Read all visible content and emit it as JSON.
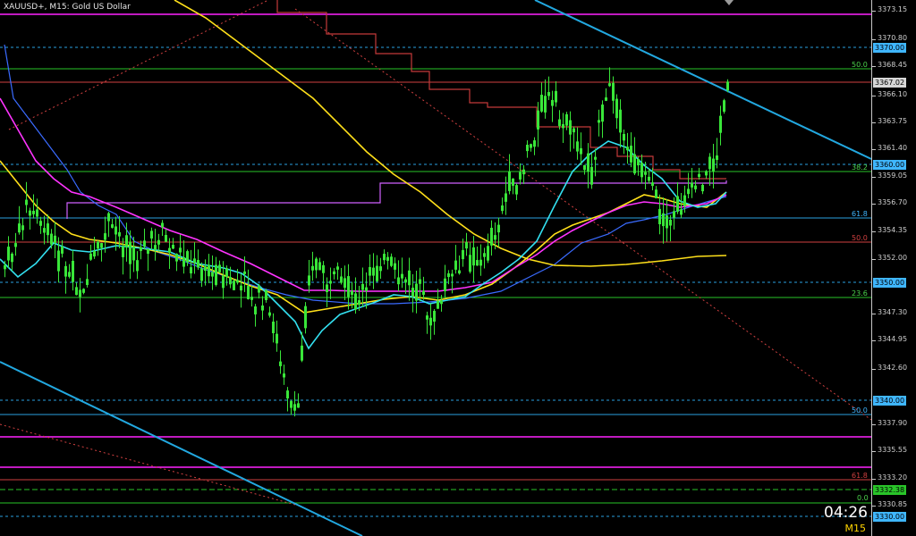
{
  "title": "XAUUSD+, M15:  Gold US Dollar",
  "timeframe": "M15",
  "countdown": "04:26",
  "price_axis": {
    "ticks": [
      "3373.15",
      "3370.80",
      "3368.45",
      "3366.10",
      "3363.75",
      "3361.40",
      "3359.05",
      "3356.70",
      "3354.35",
      "3352.00",
      "3347.30",
      "3344.95",
      "3342.60",
      "3337.90",
      "3335.55",
      "3333.20",
      "3330.85"
    ],
    "current_price": "3367.02",
    "level_tags": [
      {
        "value": "3370.00",
        "color": "#3fb6ff"
      },
      {
        "value": "3360.00",
        "color": "#3fb6ff"
      },
      {
        "value": "3350.00",
        "color": "#3fb6ff"
      },
      {
        "value": "3340.00",
        "color": "#3fb6ff"
      },
      {
        "value": "3332.38",
        "color": "#29c429"
      },
      {
        "value": "3330.00",
        "color": "#3fb6ff"
      }
    ]
  },
  "fib_labels": [
    {
      "text": "50.0",
      "color": "#4cd44c"
    },
    {
      "text": "38.2",
      "color": "#4cd44c"
    },
    {
      "text": "61.8",
      "color": "#3fb6ff"
    },
    {
      "text": "50.0",
      "color": "#d04040"
    },
    {
      "text": "23.6",
      "color": "#4cd44c"
    },
    {
      "text": "50.0",
      "color": "#3fb6ff"
    },
    {
      "text": "61.8",
      "color": "#d04040"
    },
    {
      "text": "0.0",
      "color": "#4cd44c"
    }
  ],
  "colors": {
    "background": "#000000",
    "candles": "#39e639",
    "ma_fast": "#33e0f0",
    "ma_mid": "#ff33ff",
    "ma_slow": "#ffe01a",
    "step_blue": "#3a6bff",
    "step_red": "#c43a3a",
    "step_magenta": "#d060ff",
    "trendline": "#22a8e0",
    "resistance_magenta": "#ff22ff",
    "level_blue": "#2a9fe0",
    "level_green": "#29c429"
  },
  "icons": {
    "scroll_marker": "chart-shift-triangle-icon"
  }
}
